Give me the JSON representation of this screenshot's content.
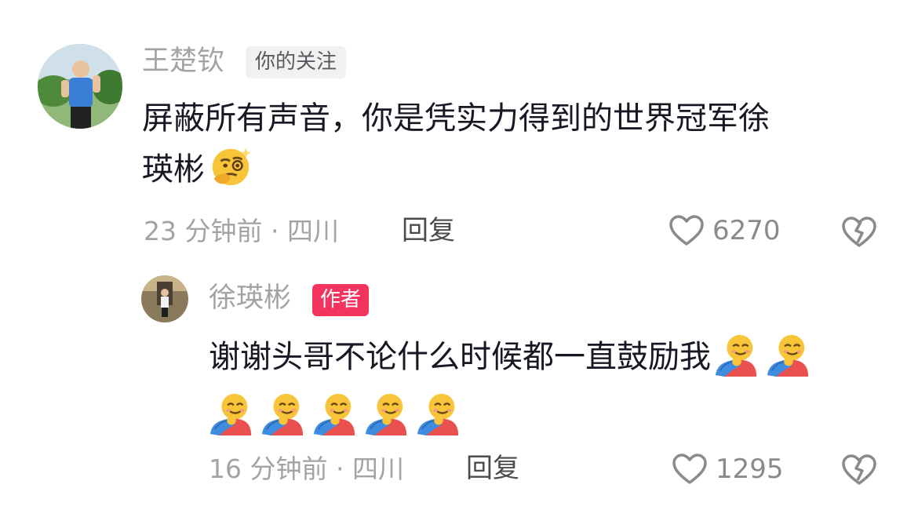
{
  "comment": {
    "username": "王楚钦",
    "badge": "你的关注",
    "text_line1": "屏蔽所有声音，你是凭实力得到的世界冠军徐",
    "text_line2": "瑛彬",
    "time": "23 分钟前 · 四川",
    "reply_label": "回复",
    "likes": "6270",
    "emoji": "face-with-monocle-thinking"
  },
  "reply": {
    "username": "徐瑛彬",
    "badge": "作者",
    "text": "谢谢头哥不论什么时候都一直鼓励我",
    "time": "16 分钟前 · 四川",
    "reply_label": "回复",
    "likes": "1295",
    "emoji": "hugging-face",
    "emoji_count": 7
  },
  "colors": {
    "author_badge": "#f3345e",
    "follow_badge_bg": "#f1f1f3",
    "text": "#161823",
    "meta": "#a3a3a6"
  }
}
